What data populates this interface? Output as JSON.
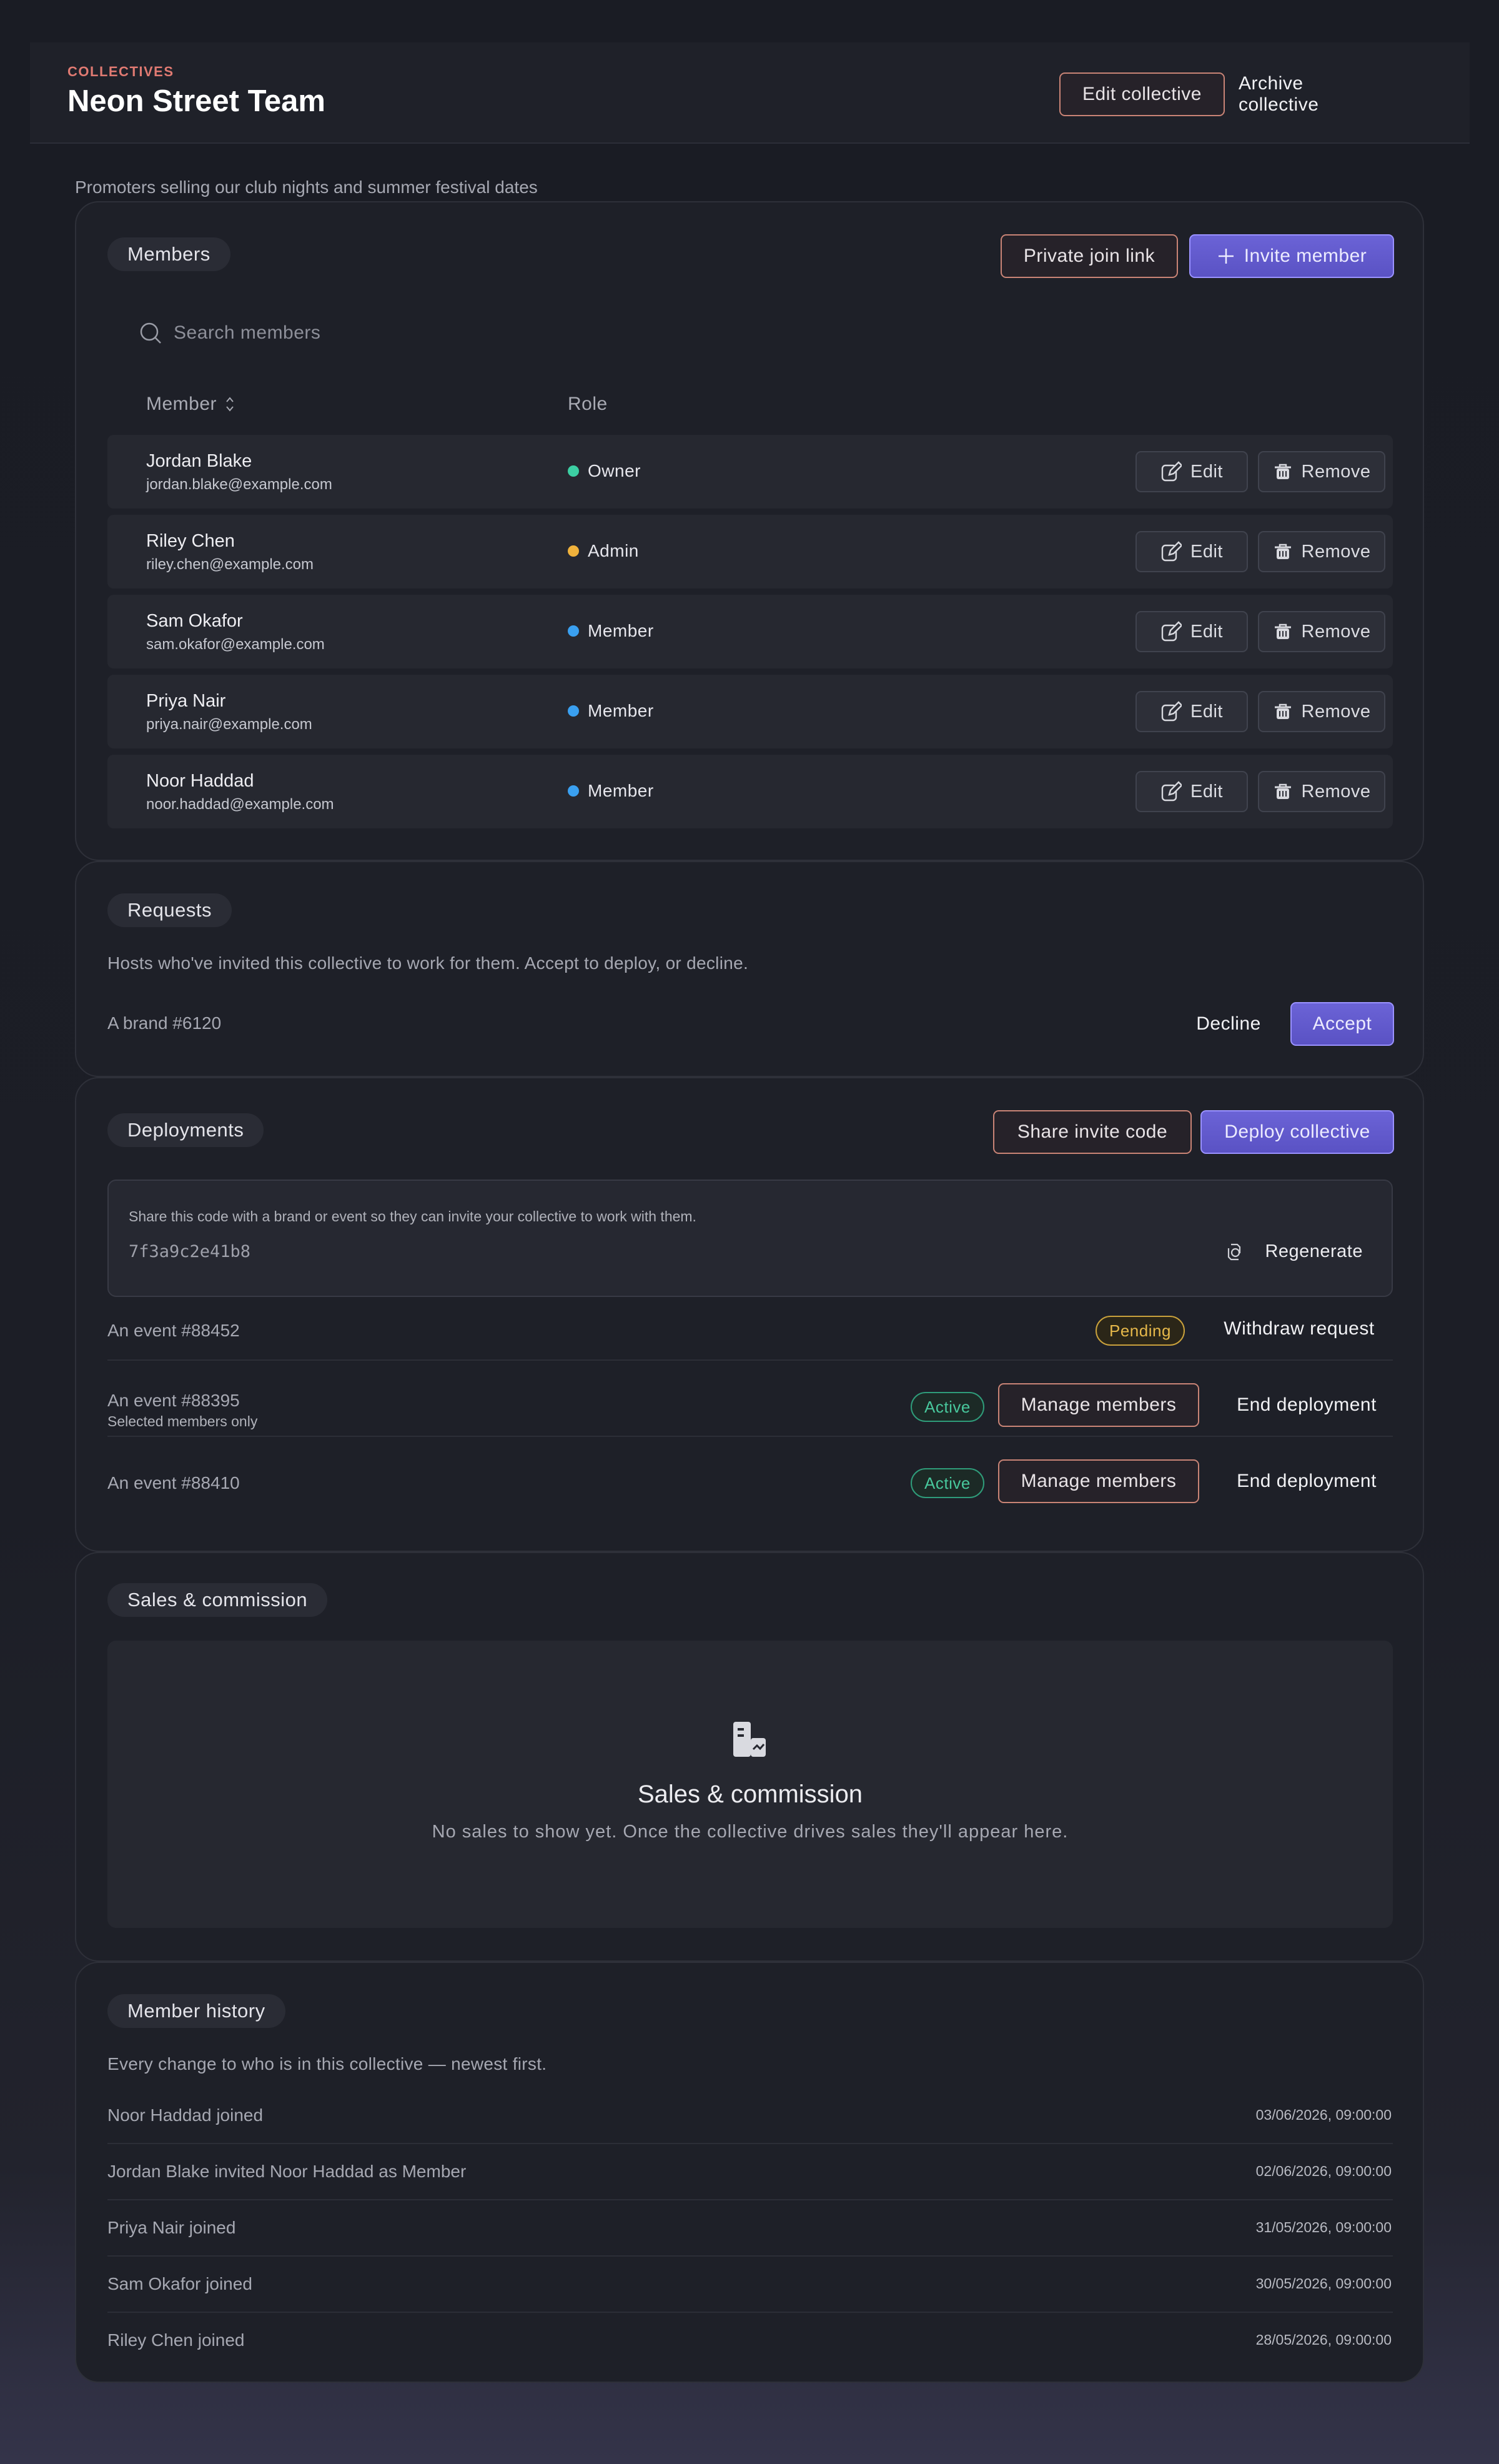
{
  "header": {
    "eyebrow": "COLLECTIVES",
    "title": "Neon Street Team",
    "edit_label": "Edit collective",
    "archive_label": "Archive collective"
  },
  "subtitle": "Promoters selling our club nights and summer festival dates",
  "members": {
    "pill": "Members",
    "private_link_label": "Private join link",
    "invite_label": "Invite member",
    "search_placeholder": "Search members",
    "col_member": "Member",
    "col_role": "Role",
    "edit_label": "Edit",
    "remove_label": "Remove",
    "rows": [
      {
        "name": "Jordan Blake",
        "email": "jordan.blake@example.com",
        "role": "Owner",
        "role_color": "#3ccfa3"
      },
      {
        "name": "Riley Chen",
        "email": "riley.chen@example.com",
        "role": "Admin",
        "role_color": "#f0b23c"
      },
      {
        "name": "Sam Okafor",
        "email": "sam.okafor@example.com",
        "role": "Member",
        "role_color": "#3aa0f0"
      },
      {
        "name": "Priya Nair",
        "email": "priya.nair@example.com",
        "role": "Member",
        "role_color": "#3aa0f0"
      },
      {
        "name": "Noor Haddad",
        "email": "noor.haddad@example.com",
        "role": "Member",
        "role_color": "#3aa0f0"
      }
    ]
  },
  "requests": {
    "pill": "Requests",
    "description": "Hosts who've invited this collective to work for them. Accept to deploy, or decline.",
    "item": "A brand #6120",
    "decline_label": "Decline",
    "accept_label": "Accept"
  },
  "deployments": {
    "pill": "Deployments",
    "share_label": "Share invite code",
    "deploy_label": "Deploy collective",
    "code_hint": "Share this code with a brand or event so they can invite your collective to work with them.",
    "code": "7f3a9c2e41b8",
    "regenerate_label": "Regenerate",
    "items": [
      {
        "title": "An event #88452",
        "sub": "",
        "status": "Pending",
        "action1": "",
        "action2": "Withdraw request"
      },
      {
        "title": "An event #88395",
        "sub": "Selected members only",
        "status": "Active",
        "action1": "Manage members",
        "action2": "End deployment"
      },
      {
        "title": "An event #88410",
        "sub": "",
        "status": "Active",
        "action1": "Manage members",
        "action2": "End deployment"
      }
    ]
  },
  "sales": {
    "pill": "Sales & commission",
    "empty_title": "Sales & commission",
    "empty_text": "No sales to show yet. Once the collective drives sales they'll appear here."
  },
  "history": {
    "pill": "Member history",
    "description": "Every change to who is in this collective — newest first.",
    "items": [
      {
        "text": "Noor Haddad joined",
        "date": "03/06/2026, 09:00:00"
      },
      {
        "text": "Jordan Blake invited Noor Haddad as Member",
        "date": "02/06/2026, 09:00:00"
      },
      {
        "text": "Priya Nair joined",
        "date": "31/05/2026, 09:00:00"
      },
      {
        "text": "Sam Okafor joined",
        "date": "30/05/2026, 09:00:00"
      },
      {
        "text": "Riley Chen joined",
        "date": "28/05/2026, 09:00:00"
      }
    ]
  }
}
